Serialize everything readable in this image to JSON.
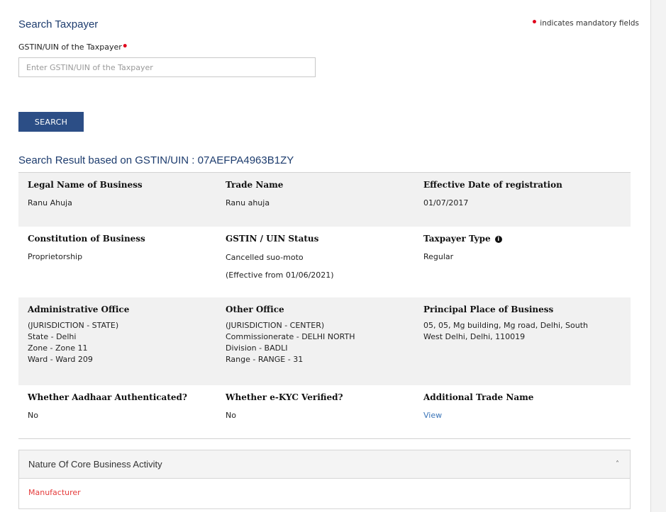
{
  "search": {
    "heading": "Search Taxpayer",
    "mandatory_dot": "•",
    "mandatory_note": "indicates mandatory fields",
    "field_label": "GSTIN/UIN of the Taxpayer",
    "required_mark": "•",
    "input_value": "",
    "placeholder": "Enter GSTIN/UIN of the Taxpayer",
    "button_label": "SEARCH"
  },
  "result": {
    "heading": "Search Result based on GSTIN/UIN : 07AEFPA4963B1ZY",
    "rows": [
      [
        {
          "label": "Legal Name of Business",
          "value": "Ranu Ahuja"
        },
        {
          "label": "Trade Name",
          "value": "Ranu ahuja"
        },
        {
          "label": "Effective Date of registration",
          "value": "01/07/2017"
        }
      ],
      [
        {
          "label": "Constitution of Business",
          "value": "Proprietorship"
        },
        {
          "label": "GSTIN / UIN Status",
          "value": "Cancelled suo-moto",
          "value2": "(Effective from 01/06/2021)"
        },
        {
          "label": "Taxpayer Type",
          "value": "Regular",
          "icon": "info-icon",
          "icon_glyph": "i"
        }
      ],
      [
        {
          "label": "Administrative Office",
          "lines": [
            "(JURISDICTION - STATE)",
            "State - Delhi",
            "Zone - Zone 11",
            "Ward - Ward 209"
          ]
        },
        {
          "label": "Other Office",
          "lines": [
            "(JURISDICTION - CENTER)",
            "Commissionerate - DELHI NORTH",
            "Division - BADLI",
            "Range - RANGE - 31"
          ]
        },
        {
          "label": "Principal Place of Business",
          "lines": [
            "05, 05, Mg building, Mg road, Delhi, South",
            "West Delhi, Delhi, 110019"
          ]
        }
      ],
      [
        {
          "label": "Whether Aadhaar Authenticated?",
          "value": "No"
        },
        {
          "label": "Whether e-KYC Verified?",
          "value": "No"
        },
        {
          "label": "Additional Trade Name",
          "link": "View"
        }
      ]
    ]
  },
  "activity": {
    "title": "Nature Of Core Business Activity",
    "chevron": "˄",
    "items": [
      "Manufacturer"
    ]
  },
  "colors": {
    "heading": "#1d3c6e",
    "button": "#2c4e86",
    "required": "#e0001b",
    "link": "#3a74b8",
    "activity_item": "#e53b3b",
    "shaded_row": "#f1f1f1"
  }
}
